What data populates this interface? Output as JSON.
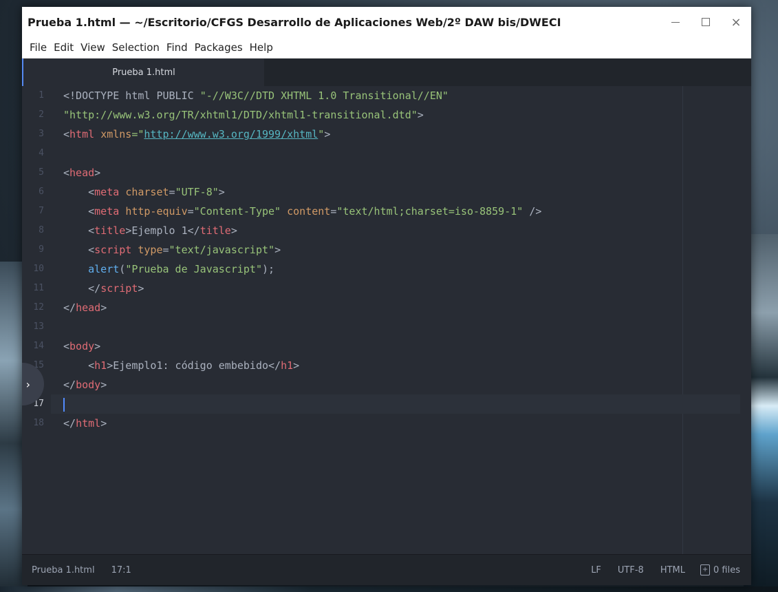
{
  "window": {
    "title": "Prueba 1.html — ~/Escritorio/CFGS Desarrollo de Aplicaciones Web/2º DAW bis/DWECI",
    "controls": {
      "minimize": "minimize",
      "maximize": "maximize",
      "close": "×"
    }
  },
  "menu": [
    "File",
    "Edit",
    "View",
    "Selection",
    "Find",
    "Packages",
    "Help"
  ],
  "tabs": [
    {
      "label": "Prueba 1.html",
      "active": true
    }
  ],
  "editor": {
    "line_numbers": [
      "1",
      "2",
      "3",
      "4",
      "5",
      "6",
      "7",
      "8",
      "9",
      "10",
      "11",
      "12",
      "13",
      "14",
      "15",
      "16",
      "17",
      "18"
    ],
    "active_line": 17
  },
  "code": {
    "l1_a": "<!DOCTYPE html PUBLIC ",
    "l1_b": "\"-//W3C//DTD XHTML 1.0 Transitional//EN\"",
    "l2": "\"http://www.w3.org/TR/xhtml1/DTD/xhtml1-transitional.dtd\"",
    "l2_end": ">",
    "lt": "<",
    "ltslash": "</",
    "gt": ">",
    "html": "html",
    "xmlns": "xmlns",
    "eq_q": "=\"",
    "q": "\"",
    "xmlns_url": "http://www.w3.org/1999/xhtml",
    "head": "head",
    "meta": "meta",
    "charset": "charset",
    "utf8": "\"UTF-8\"",
    "http_equiv": "http-equiv",
    "content_type": "\"Content-Type\"",
    "content": "content",
    "content_val": "\"text/html;charset=iso-8859-1\"",
    "selfclose": " />",
    "title": "title",
    "title_text": "Ejemplo 1",
    "script": "script",
    "type": "type",
    "type_val": "\"text/javascript\"",
    "alert": "alert",
    "alert_arg": "\"Prueba de Javascript\"",
    "alert_end": ");",
    "paren": "(",
    "body": "body",
    "h1": "h1",
    "h1_text": "Ejemplo1: código embebido",
    "indent": "    ",
    "space": " ",
    "eq": "="
  },
  "status": {
    "file": "Prueba 1.html",
    "cursor": "17:1",
    "line_ending": "LF",
    "encoding": "UTF-8",
    "grammar": "HTML",
    "files": "0 files"
  }
}
